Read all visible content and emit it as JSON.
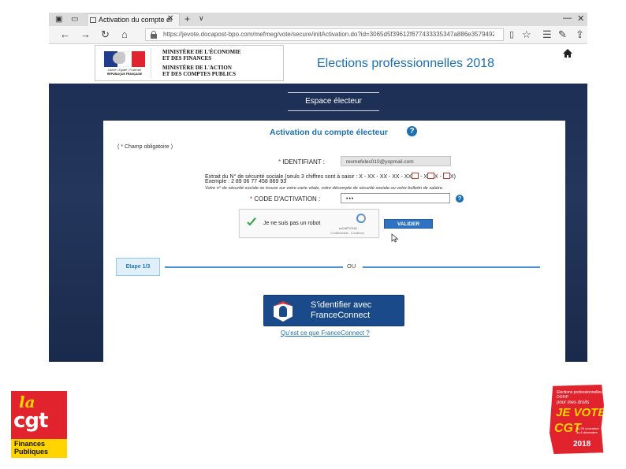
{
  "browser": {
    "tab_title": "Activation du compte él",
    "tab_close": "✕",
    "new_tab": "+",
    "tab_list": "∨",
    "window_min": "—",
    "window_close": "✕",
    "url": "https://jevote.docapost-bpo.com/mefmeg/vote/secure/initActivation.do?id=3065d5f39612f677433335347a886e35794921",
    "nav_icons": [
      "back-icon",
      "forward-icon",
      "refresh-icon",
      "home-icon"
    ],
    "toolbar_icons": [
      "reading-view-icon",
      "favorite-star-icon",
      "favorites-hub-icon",
      "notes-icon",
      "share-icon"
    ]
  },
  "header": {
    "ministry_line1": "MINISTÈRE DE L'ÉCONOMIE",
    "ministry_line2": "ET DES FINANCES",
    "ministry_line3": "MINISTÈRE DE L'ACTION",
    "ministry_line4": "ET DES COMPTES PUBLICS",
    "marianne_motto": "Liberté • Égalité • Fraternité",
    "marianne_rf": "RÉPUBLIQUE FRANÇAISE",
    "elections_title": "Elections professionnelles 2018"
  },
  "nav": {
    "espace_electeur": "Espace électeur"
  },
  "form": {
    "title": "Activation du compte électeur",
    "help_glyph": "?",
    "required_note": "( * Champ obligatoire )",
    "required_star": "*",
    "identifiant_label": "IDENTIFIANT :",
    "identifiant_value": "revmefelec010@yopmail.com",
    "ssn_instruction": "Extrait du N° de sécurité sociale (seuls 3 chiffres sont à saisir : X - XX - XX - XX - XX",
    "ssn_instruction_sep1": " - X",
    "ssn_instruction_sep2": "X - ",
    "ssn_instruction_end": "X)",
    "ssn_example": "Exemple : 2 89 06 77 458 869 93",
    "ssn_note": "Votre n° de sécurité sociale se trouve sur votre carte vitale, votre décompte de sécurité sociale ou votre bulletin de salaire.",
    "code_label": "CODE D'ACTIVATION :",
    "code_value": "•••",
    "captcha_label": "Je ne suis pas un robot",
    "captcha_brand": "reCAPTCHA",
    "captcha_terms": "Confidentialité - Conditions",
    "valider_label": "VALIDER",
    "step_label": "Etape 1/3",
    "or_label": "OU",
    "franceconnect_line1": "S'identifier avec",
    "franceconnect_line2": "FranceConnect",
    "franceconnect_link": "Qu'est ce que FranceConnect ?"
  },
  "logos": {
    "cgt_la": "la",
    "cgt_word": "cgt",
    "cgt_finances": "Finances",
    "cgt_publiques": "Publiques",
    "vote_line1": "Elections professionnelles",
    "vote_line2": "DGFiP",
    "vote_line3": "pour mes droits",
    "vote_big1": "JE VOTE",
    "vote_big2": "CGT",
    "vote_date1": "du 29 novembre",
    "vote_date2": "au 6 décembre",
    "vote_year": "2018"
  },
  "colors": {
    "accent_blue": "#1c6fb0",
    "dark_band": "#1d2f55",
    "cgt_red": "#e1232d",
    "cgt_yellow": "#ffd400"
  }
}
